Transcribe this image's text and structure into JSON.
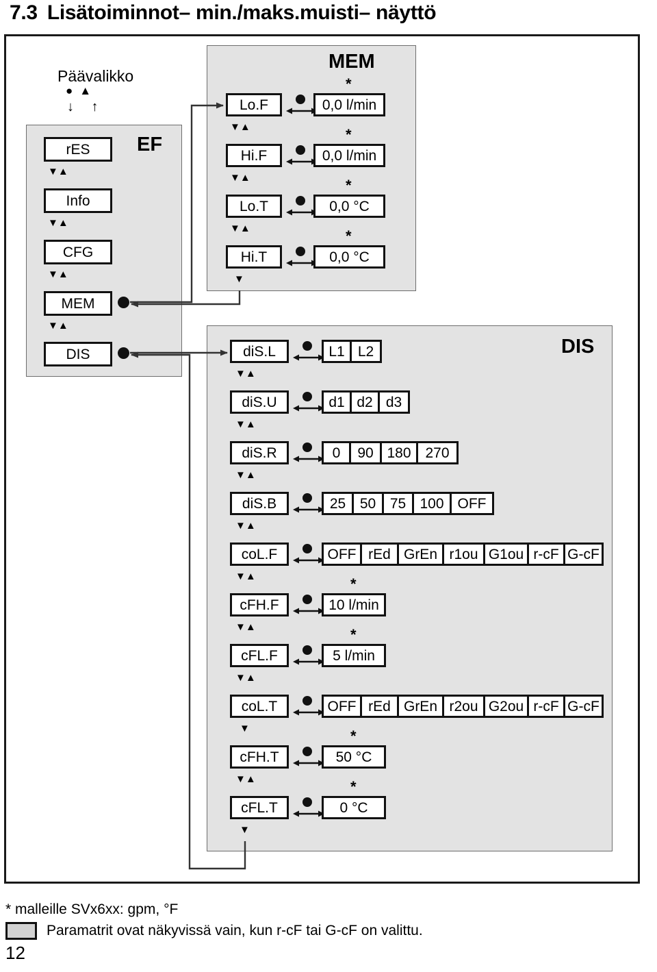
{
  "document": {
    "title_number": "7.3",
    "title_text": "Lisätoiminnot– min./maks.muisti– näyttö",
    "page_number": "12"
  },
  "main_menu": {
    "label": "Päävalikko",
    "keys": "●▲",
    "arrows": "↓ ↑",
    "panel_tag": "EF",
    "items": [
      {
        "label": "rES"
      },
      {
        "label": "Info"
      },
      {
        "label": "CFG"
      },
      {
        "label": "MEM"
      },
      {
        "label": "DIS"
      }
    ],
    "separator": "▼▲"
  },
  "mem_panel": {
    "tag": "MEM",
    "rows": [
      {
        "label": "Lo.F",
        "value": "0,0 l/min",
        "asterisk": "*"
      },
      {
        "label": "Hi.F",
        "value": "0,0 l/min",
        "asterisk": "*"
      },
      {
        "label": "Lo.T",
        "value": "0,0 °C",
        "asterisk": "*"
      },
      {
        "label": "Hi.T",
        "value": "0,0 °C",
        "asterisk": "*"
      }
    ],
    "separator": "▼▲",
    "exit_arrow": "▼"
  },
  "dis_panel": {
    "tag": "DIS",
    "rows": [
      {
        "label": "diS.L",
        "options": [
          "L1",
          "L2"
        ]
      },
      {
        "label": "diS.U",
        "options": [
          "d1",
          "d2",
          "d3"
        ]
      },
      {
        "label": "diS.R",
        "options": [
          "0",
          "90",
          "180",
          "270"
        ]
      },
      {
        "label": "diS.B",
        "options": [
          "25",
          "50",
          "75",
          "100",
          "OFF"
        ]
      },
      {
        "label": "coL.F",
        "options": [
          "OFF",
          "rEd",
          "GrEn",
          "r1ou",
          "G1ou",
          "r-cF",
          "G-cF"
        ]
      },
      {
        "label": "cFH.F",
        "value": "10 l/min",
        "asterisk": "*"
      },
      {
        "label": "cFL.F",
        "value": "5 l/min",
        "asterisk": "*"
      },
      {
        "label": "coL.T",
        "options": [
          "OFF",
          "rEd",
          "GrEn",
          "r2ou",
          "G2ou",
          "r-cF",
          "G-cF"
        ]
      },
      {
        "label": "cFH.T",
        "value": "50 °C",
        "asterisk": "*"
      },
      {
        "label": "cFL.T",
        "value": "0 °C",
        "asterisk": "*"
      }
    ],
    "separator": "▼▲",
    "single_down": "▼",
    "exit_arrow": "▼"
  },
  "footnotes": {
    "asterisk_note": "* malleille SVx6xx: gpm, °F",
    "gray_note": "Paramatrit ovat näkyvissä vain, kun r-cF tai G-cF on valittu.",
    "swatch_color": "#d2d2d2"
  },
  "colors": {
    "panel_gray": "#e3e3e3",
    "line_black": "#111111",
    "page_white": "#ffffff"
  }
}
